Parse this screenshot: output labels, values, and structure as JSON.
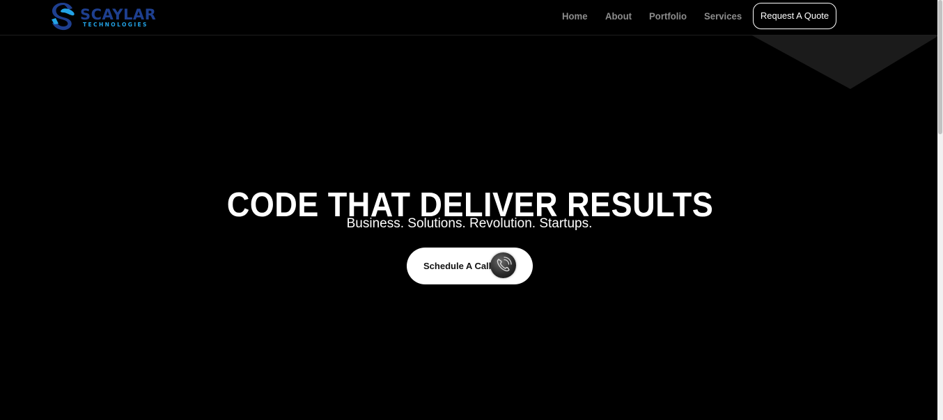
{
  "brand": {
    "name": "SCAYLAR",
    "tagline": "TECHNOLOGIES",
    "colors": {
      "dark_blue": "#1e3f8f",
      "light_blue": "#22a3e6"
    }
  },
  "nav": {
    "items": [
      {
        "label": "Home"
      },
      {
        "label": "About"
      },
      {
        "label": "Portfolio"
      },
      {
        "label": "Services"
      }
    ],
    "cta_label": "Request A Quote"
  },
  "hero": {
    "title": "CODE THAT DELIVER RESULTS",
    "subtitle": "Business. Solutions. Revolution. Startups.",
    "button_label": "Schedule A Call",
    "button_icon": "phone-icon"
  },
  "theme": {
    "background": "#000000",
    "text": "#ffffff",
    "nav_text": "#8d8d8d"
  }
}
